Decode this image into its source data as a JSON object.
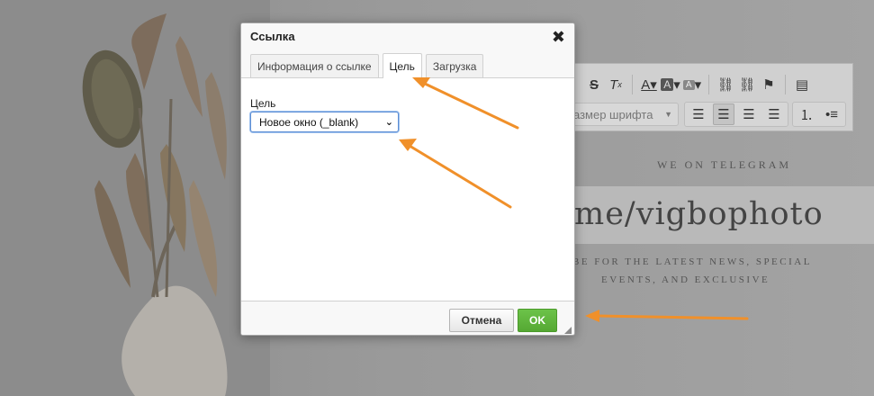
{
  "background": {
    "toolbar": {
      "font_size_placeholder": "азмер шрифта"
    },
    "telegram": {
      "heading": "WE ON TELEGRAM",
      "handle": "me/vigbophoto",
      "subtitle_line1": "RIBE FOR THE LATEST NEWS, SPECIAL",
      "subtitle_line2": "EVENTS, AND EXCLUSIVE"
    }
  },
  "dialog": {
    "title": "Ссылка",
    "close_glyph": "✖",
    "tabs": [
      {
        "label": "Информация о ссылке",
        "active": false
      },
      {
        "label": "Цель",
        "active": true
      },
      {
        "label": "Загрузка",
        "active": false
      }
    ],
    "target_field": {
      "label": "Цель",
      "selected": "Новое окно (_blank)"
    },
    "buttons": {
      "cancel": "Отмена",
      "ok": "OK"
    }
  },
  "colors": {
    "annotation_arrow": "#f0902a",
    "ok_button": "#5cb23a",
    "select_focus": "#5d8ed4"
  }
}
